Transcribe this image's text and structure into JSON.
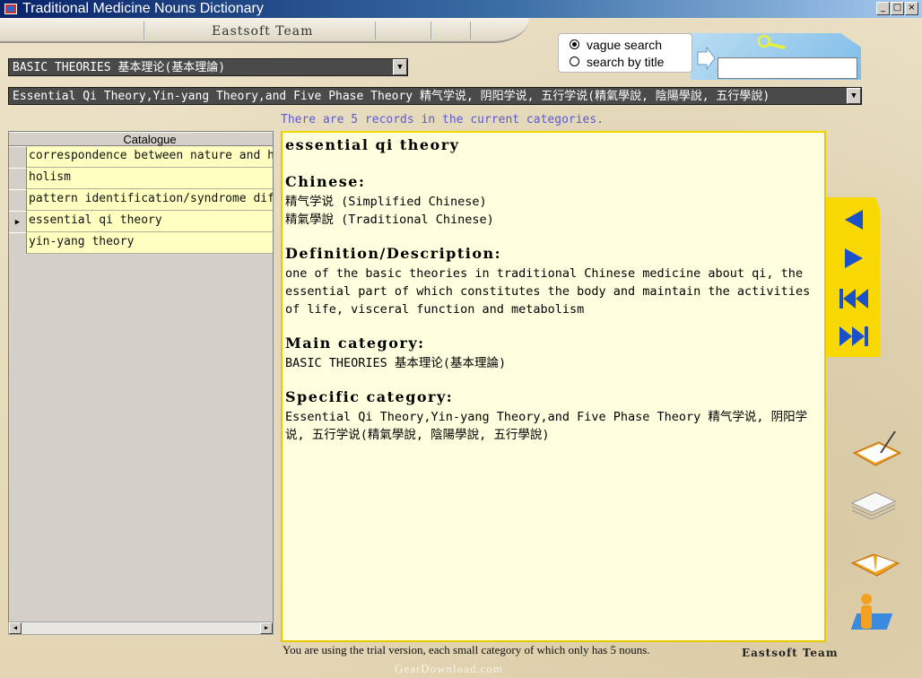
{
  "window": {
    "title": "Traditional Medicine Nouns Dictionary",
    "buttons": {
      "minimize": "_",
      "maximize": "□",
      "close": "×"
    }
  },
  "header": {
    "team": "Eastsoft Team"
  },
  "search": {
    "options": [
      {
        "label": "vague search",
        "selected": true
      },
      {
        "label": "search by title",
        "selected": false
      }
    ],
    "value": ""
  },
  "main_category": {
    "selected": "BASIC THEORIES 基本理论(基本理論)"
  },
  "specific_category": {
    "selected": "Essential Qi Theory,Yin-yang Theory,and Five Phase Theory 精气学说, 阴阳学说, 五行学说(精氣學說, 陰陽學說, 五行學說)"
  },
  "records_text": "There are 5 records in the current categories.",
  "catalogue": {
    "header": "Catalogue",
    "rows": [
      {
        "label": "correspondence between nature and human",
        "current": false
      },
      {
        "label": "holism",
        "current": false
      },
      {
        "label": "pattern identification/syndrome differentiation",
        "current": false
      },
      {
        "label": "essential qi theory",
        "current": true
      },
      {
        "label": "yin-yang theory",
        "current": false
      }
    ]
  },
  "detail": {
    "term": "essential qi theory",
    "chinese_heading": "Chinese:",
    "chinese_simplified": "精气学说  (Simplified Chinese)",
    "chinese_traditional": "精氣學說  (Traditional Chinese)",
    "definition_heading": "Definition/Description:",
    "definition": "one of the basic theories in traditional Chinese medicine about qi, the essential  part of which constitutes the body and maintain the activities of life, visceral function and metabolism",
    "main_heading": "Main category:",
    "main_category": "BASIC THEORIES 基本理论(基本理論)",
    "specific_heading": "Specific category:",
    "specific_category": "Essential Qi Theory,Yin-yang Theory,and Five Phase Theory 精气学说, 阴阳学说, 五行学说(精氣學說, 陰陽學說, 五行學說)"
  },
  "footer": {
    "trial": "You are using the trial version, each small category of which only has 5 nouns.",
    "team": "Eastsoft Team",
    "watermark": "GearDownload.com"
  },
  "colors": {
    "nav_accent": "#f8d800",
    "nav_icon": "#1a50c8",
    "detail_bg": "#ffffe0",
    "row_bg": "#ffffc0",
    "records_text": "#5a5ad0"
  }
}
